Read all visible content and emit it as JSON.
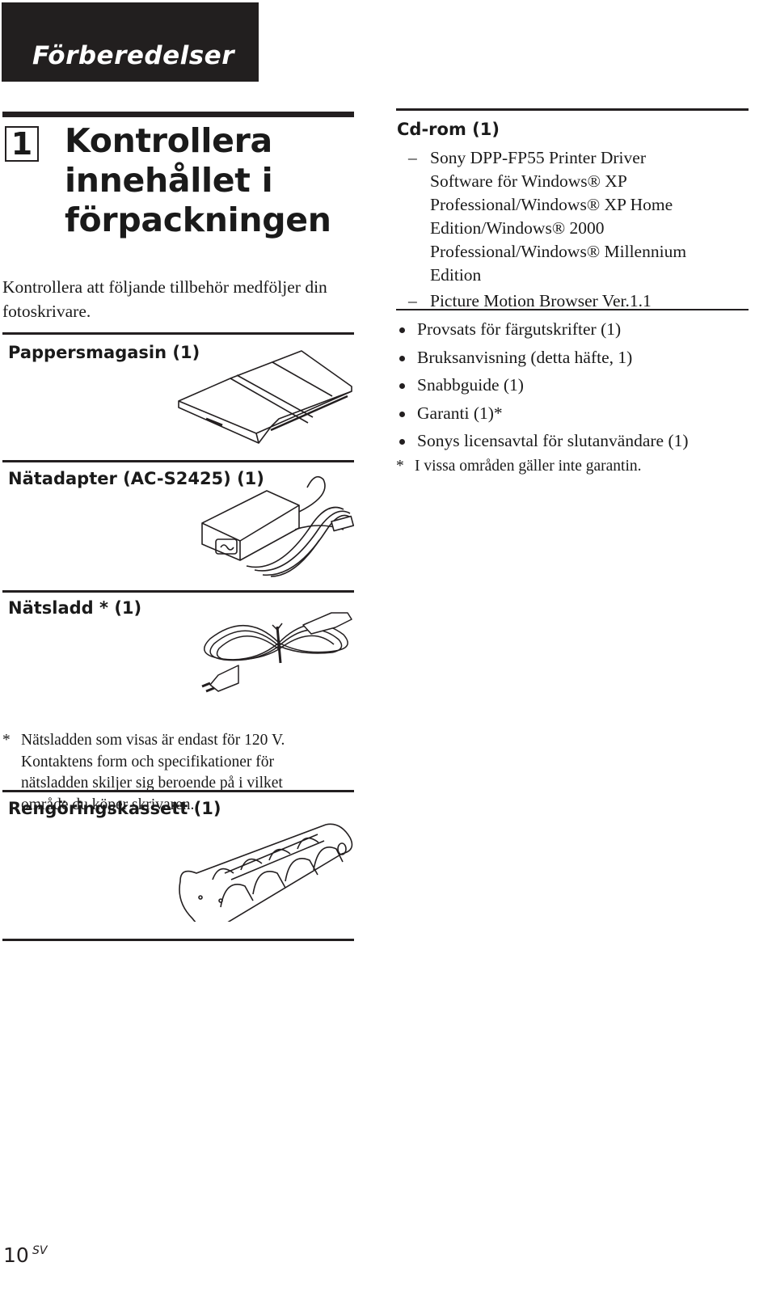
{
  "chapter": {
    "title": "Förberedelser"
  },
  "step": {
    "number": "1",
    "title_lines": [
      "Kontrollera",
      "innehållet i",
      "förpackningen"
    ],
    "intro": "Kontrollera att följande tillbehör medföljer din fotoskrivare."
  },
  "items": [
    {
      "heading": "Pappersmagasin (1)",
      "illustration": "paper-tray-illustration"
    },
    {
      "heading": "Nätadapter (AC-S2425) (1)",
      "illustration": "ac-adapter-illustration"
    },
    {
      "heading": "Nätsladd * (1)",
      "illustration": "power-cord-illustration"
    },
    {
      "heading": "Rengöringskassett (1)",
      "illustration": "cleaning-cassette-illustration"
    }
  ],
  "cord_footnote": {
    "marker": "*",
    "lines": [
      "Nätsladden som visas är endast för 120 V.",
      "Kontaktens form och specifikationer för",
      "nätsladden skiljer sig beroende på i vilket",
      "område du köper skrivaren."
    ]
  },
  "cdrom": {
    "heading": "Cd-rom (1)",
    "dash_symbol": "–",
    "entries": [
      {
        "lines": [
          "Sony DPP-FP55 Printer Driver",
          "Software för Windows® XP",
          "Professional/Windows® XP Home",
          "Edition/Windows® 2000",
          "Professional/Windows® Millennium",
          "Edition"
        ]
      },
      {
        "lines": [
          "Picture Motion Browser Ver.1.1"
        ]
      }
    ]
  },
  "bullets": [
    "Provsats för färgutskrifter (1)",
    "Bruksanvisning (detta häfte, 1)",
    "Snabbguide (1)",
    "Garanti (1)*",
    "Sonys licensavtal för slutanvändare (1)"
  ],
  "warranty_note": {
    "marker": "*",
    "text": "I vissa områden gäller inte garantin."
  },
  "footer": {
    "page_number": "10",
    "language_code": "SV"
  }
}
